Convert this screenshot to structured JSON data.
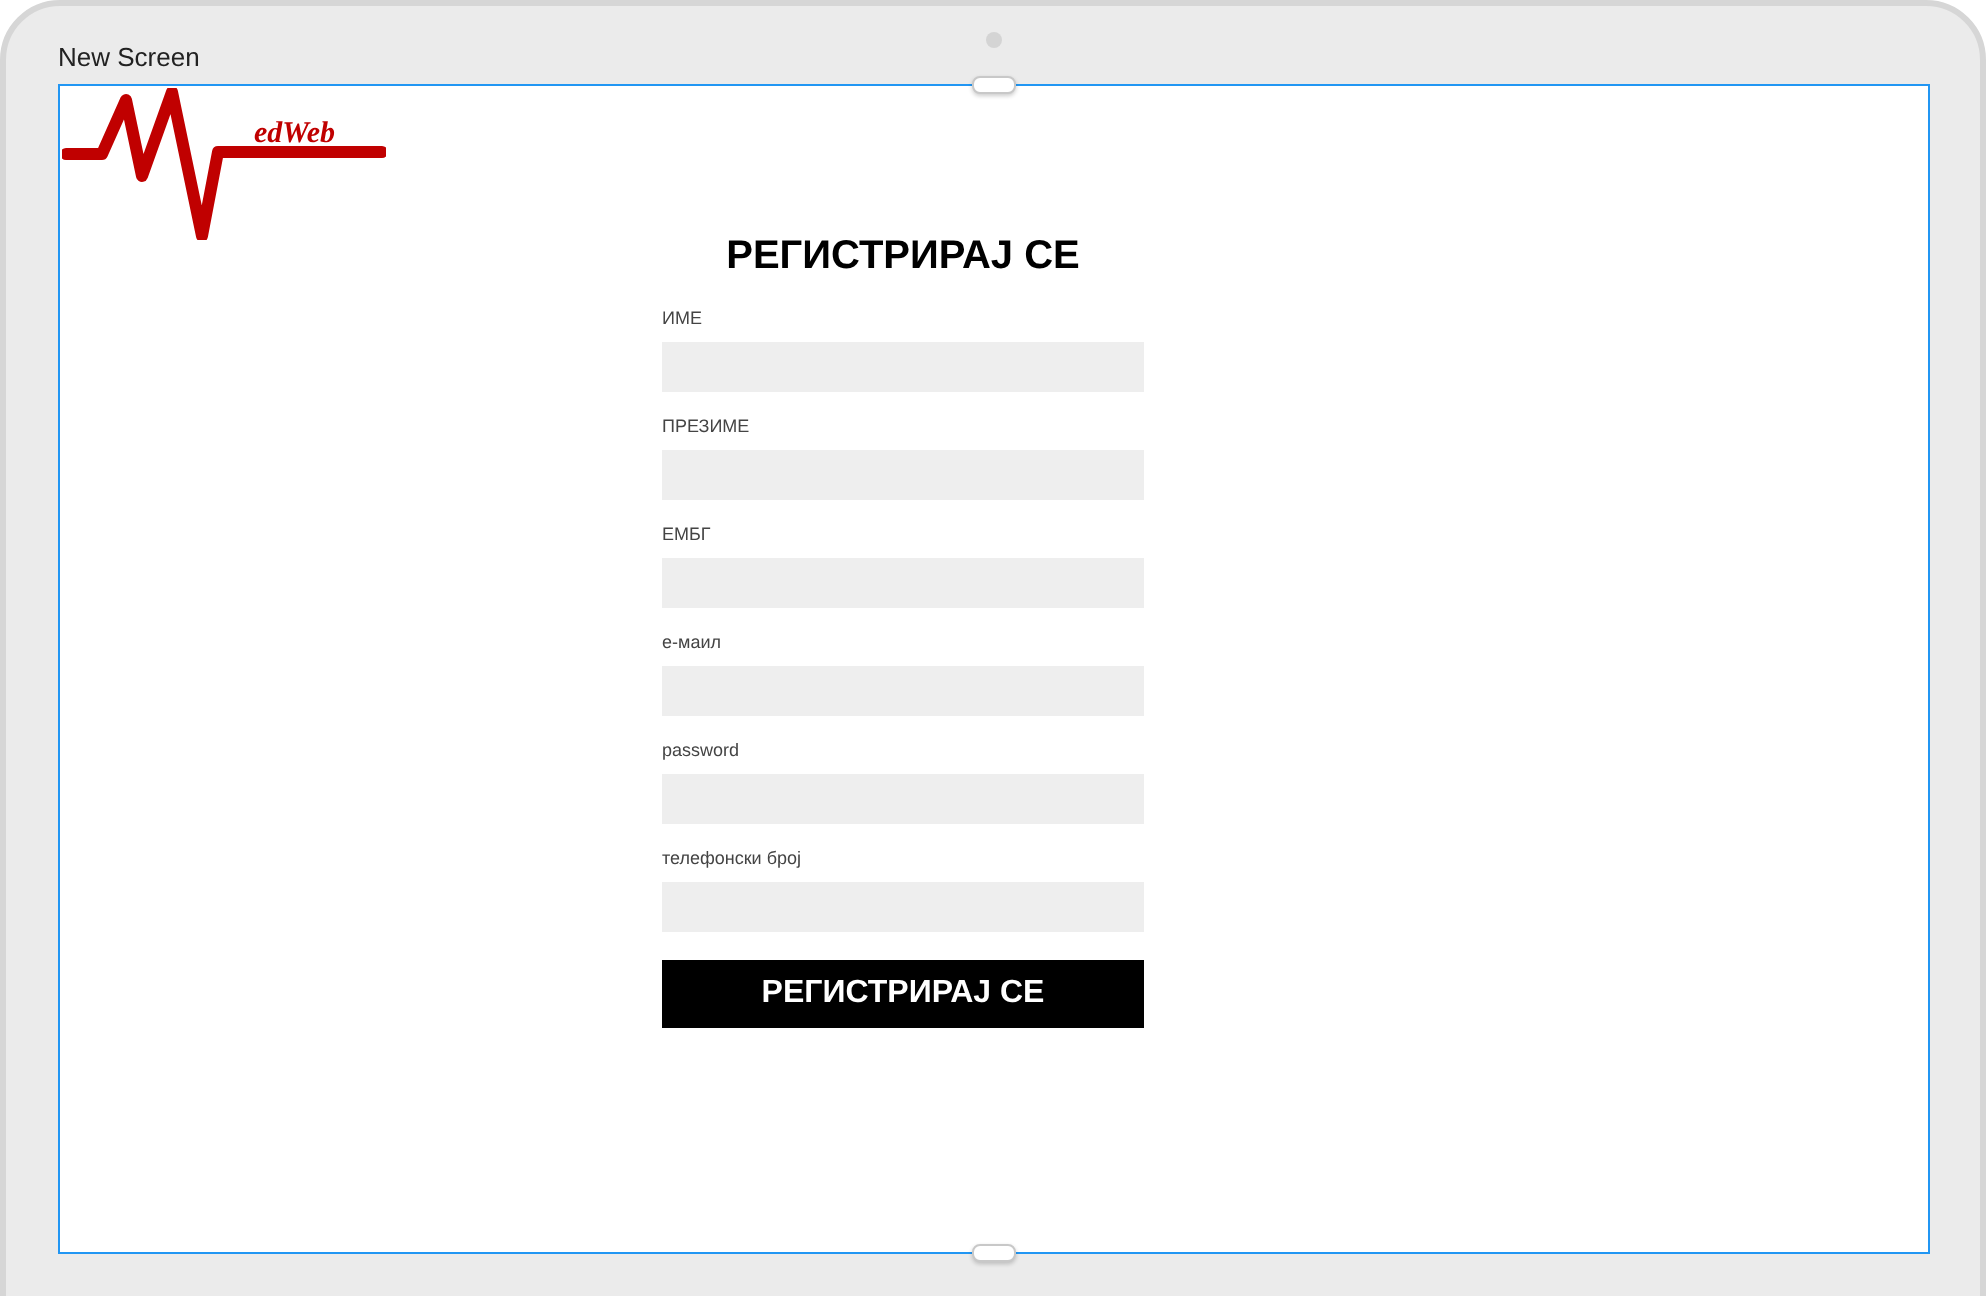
{
  "screen": {
    "title": "New Screen"
  },
  "logo": {
    "text": "edWeb"
  },
  "form": {
    "title": "РЕГИСТРИРАЈ СЕ",
    "fields": [
      {
        "label": "ИМЕ"
      },
      {
        "label": "ПРЕЗИМЕ"
      },
      {
        "label": "ЕМБГ"
      },
      {
        "label": "е-маил"
      },
      {
        "label": "password"
      },
      {
        "label": "телефонски број"
      }
    ],
    "submit": "РЕГИСТРИРАЈ СЕ"
  }
}
